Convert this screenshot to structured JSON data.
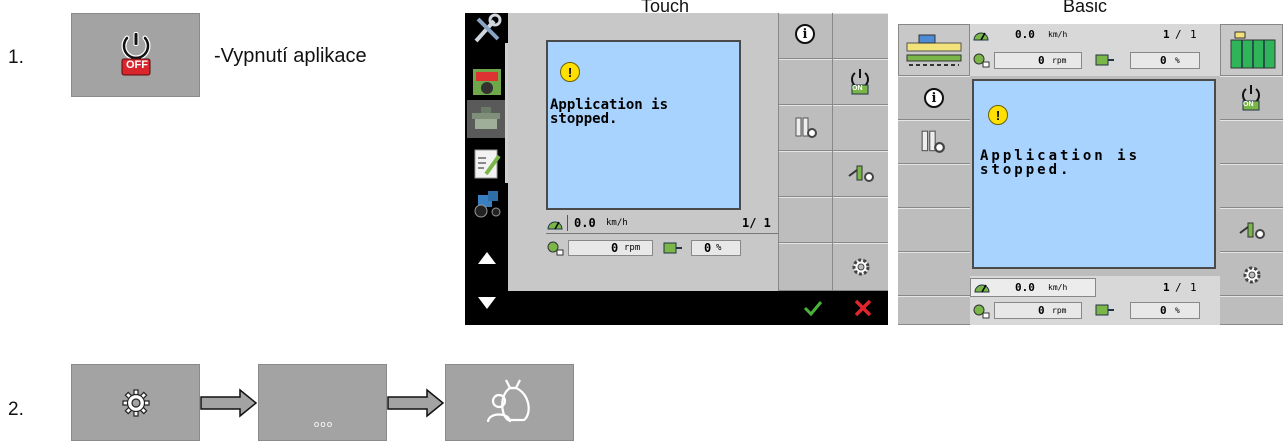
{
  "steps": {
    "step1_number": "1.",
    "step1_caption": "-Vypnutí aplikace",
    "step1_icon_label": "OFF",
    "step2_number": "2.",
    "step2_dots": "ooo"
  },
  "columns": {
    "touch_label": "Touch",
    "basic_label": "Basic"
  },
  "touch_screen": {
    "message": "Application is stopped.",
    "speed_value": "0.0",
    "speed_unit": "km/h",
    "page": "1/ 1",
    "rpm_value": "0",
    "rpm_unit": "rpm",
    "pct_value": "0",
    "pct_unit": "%",
    "on_label": "ON"
  },
  "basic_screen": {
    "message": "Application is stopped.",
    "speed_value": "0.0",
    "speed_unit": "km/h",
    "page_a": "1",
    "page_sep": "/",
    "page_b": "1",
    "rpm_value": "0",
    "rpm_unit": "rpm",
    "pct_value": "0",
    "pct_unit": "%",
    "on_label": "ON"
  },
  "colors": {
    "button_gray": "#a3a3a3",
    "message_blue": "#a9d3ff",
    "warning_yellow": "#ffe000",
    "off_red": "#d9262c",
    "confirm_green": "#49b43a",
    "cancel_red": "#e0262c"
  }
}
